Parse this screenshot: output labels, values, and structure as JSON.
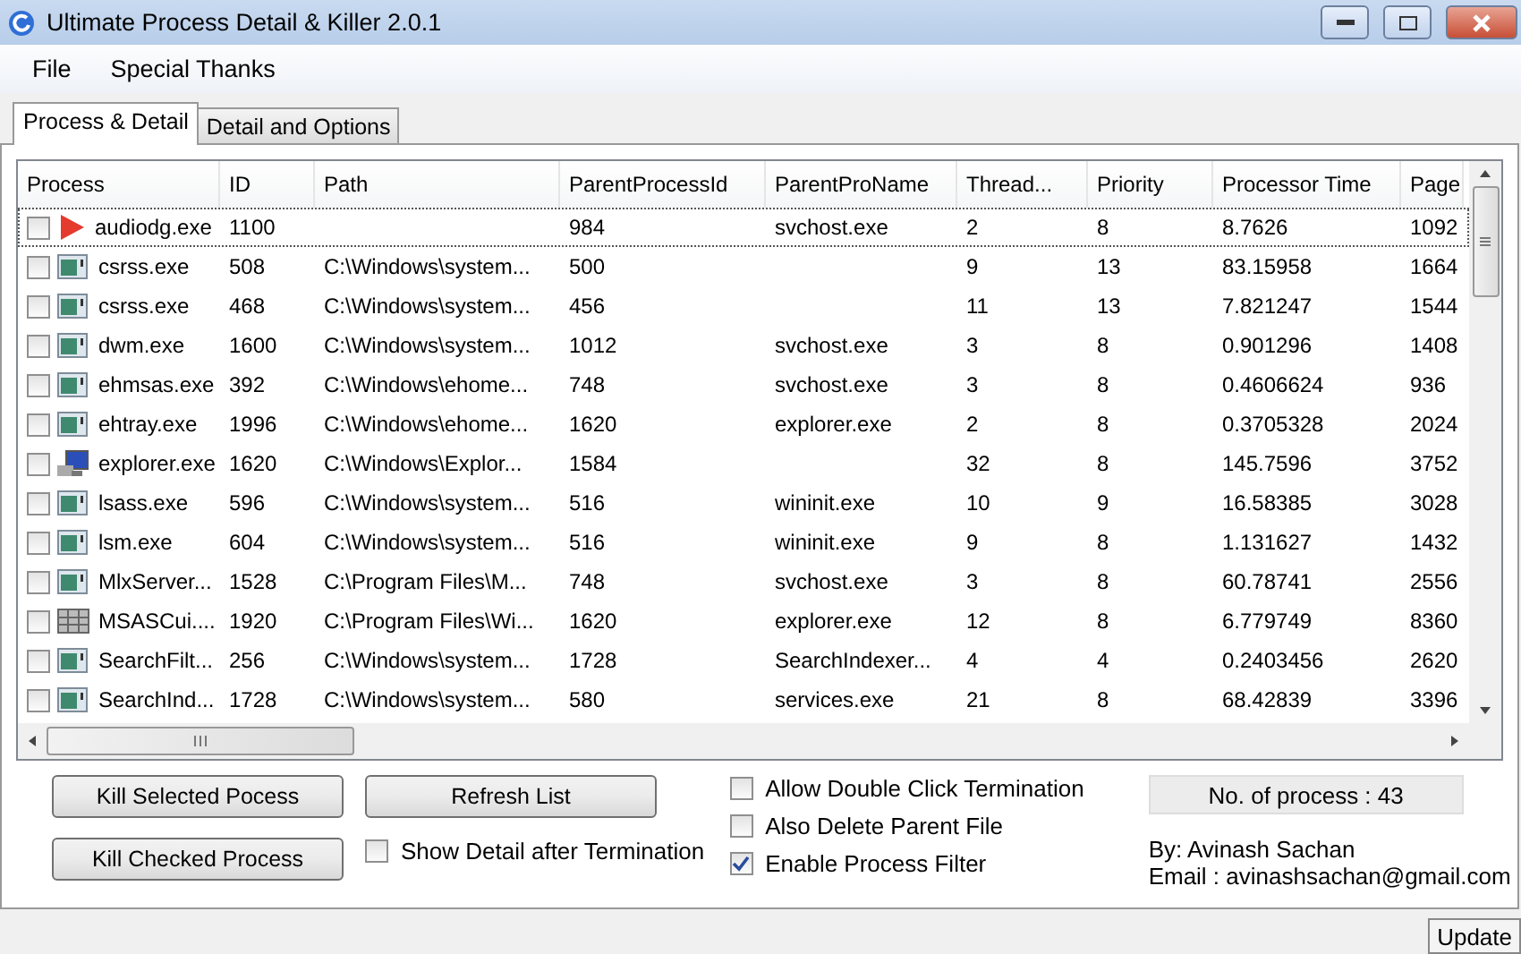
{
  "window": {
    "title": "Ultimate Process Detail & Killer 2.0.1"
  },
  "menu": [
    "File",
    "Special Thanks"
  ],
  "tabs": [
    {
      "label": "Process & Detail",
      "selected": true
    },
    {
      "label": "Detail and Options",
      "selected": false
    }
  ],
  "table": {
    "columns": [
      "Process",
      "ID",
      "Path",
      "ParentProcessId",
      "ParentProName",
      "Thread...",
      "Priority",
      "Processor Time",
      "Page"
    ],
    "rows": [
      {
        "kind": "play",
        "checked": false,
        "focused": true,
        "cells": [
          "audiodg.exe",
          "1100",
          "",
          "984",
          "svchost.exe",
          "2",
          "8",
          "8.7626",
          "1092"
        ]
      },
      {
        "kind": "window",
        "checked": false,
        "focused": false,
        "cells": [
          "csrss.exe",
          "508",
          "C:\\Windows\\system...",
          "500",
          "",
          "9",
          "13",
          "83.15958",
          "1664"
        ]
      },
      {
        "kind": "window",
        "checked": false,
        "focused": false,
        "cells": [
          "csrss.exe",
          "468",
          "C:\\Windows\\system...",
          "456",
          "",
          "11",
          "13",
          "7.821247",
          "1544"
        ]
      },
      {
        "kind": "window",
        "checked": false,
        "focused": false,
        "cells": [
          "dwm.exe",
          "1600",
          "C:\\Windows\\system...",
          "1012",
          "svchost.exe",
          "3",
          "8",
          "0.901296",
          "1408"
        ]
      },
      {
        "kind": "window",
        "checked": false,
        "focused": false,
        "cells": [
          "ehmsas.exe",
          "392",
          "C:\\Windows\\ehome...",
          "748",
          "svchost.exe",
          "3",
          "8",
          "0.4606624",
          "936"
        ]
      },
      {
        "kind": "window",
        "checked": false,
        "focused": false,
        "cells": [
          "ehtray.exe",
          "1996",
          "C:\\Windows\\ehome...",
          "1620",
          "explorer.exe",
          "2",
          "8",
          "0.3705328",
          "2024"
        ]
      },
      {
        "kind": "computer",
        "checked": false,
        "focused": false,
        "cells": [
          "explorer.exe",
          "1620",
          "C:\\Windows\\Explor...",
          "1584",
          "",
          "32",
          "8",
          "145.7596",
          "3752"
        ]
      },
      {
        "kind": "window",
        "checked": false,
        "focused": false,
        "cells": [
          "lsass.exe",
          "596",
          "C:\\Windows\\system...",
          "516",
          "wininit.exe",
          "10",
          "9",
          "16.58385",
          "3028"
        ]
      },
      {
        "kind": "window",
        "checked": false,
        "focused": false,
        "cells": [
          "lsm.exe",
          "604",
          "C:\\Windows\\system...",
          "516",
          "wininit.exe",
          "9",
          "8",
          "1.131627",
          "1432"
        ]
      },
      {
        "kind": "window",
        "checked": false,
        "focused": false,
        "cells": [
          "MlxServer...",
          "1528",
          "C:\\Program Files\\M...",
          "748",
          "svchost.exe",
          "3",
          "8",
          "60.78741",
          "2556"
        ]
      },
      {
        "kind": "grid",
        "checked": false,
        "focused": false,
        "cells": [
          "MSASCui....",
          "1920",
          "C:\\Program Files\\Wi...",
          "1620",
          "explorer.exe",
          "12",
          "8",
          "6.779749",
          "8360"
        ]
      },
      {
        "kind": "window",
        "checked": false,
        "focused": false,
        "cells": [
          "SearchFilt...",
          "256",
          "C:\\Windows\\system...",
          "1728",
          "SearchIndexer...",
          "4",
          "4",
          "0.2403456",
          "2620"
        ]
      },
      {
        "kind": "window",
        "checked": false,
        "focused": false,
        "cells": [
          "SearchInd...",
          "1728",
          "C:\\Windows\\system...",
          "580",
          "services.exe",
          "21",
          "8",
          "68.42839",
          "3396"
        ]
      }
    ]
  },
  "buttons": [
    "Kill Selected Pocess",
    "Refresh List",
    "Kill Checked Process"
  ],
  "options": [
    {
      "label": "Show Detail after Termination",
      "checked": false
    },
    {
      "label": "Allow Double Click Termination",
      "checked": false
    },
    {
      "label": "Also Delete Parent File",
      "checked": false
    },
    {
      "label": "Enable Process Filter",
      "checked": true
    }
  ],
  "process_count": "No. of process : 43",
  "author": "By: Avinash Sachan",
  "email": "Email : avinashsachan@gmail.com",
  "status_bar": {
    "button": "Update"
  }
}
